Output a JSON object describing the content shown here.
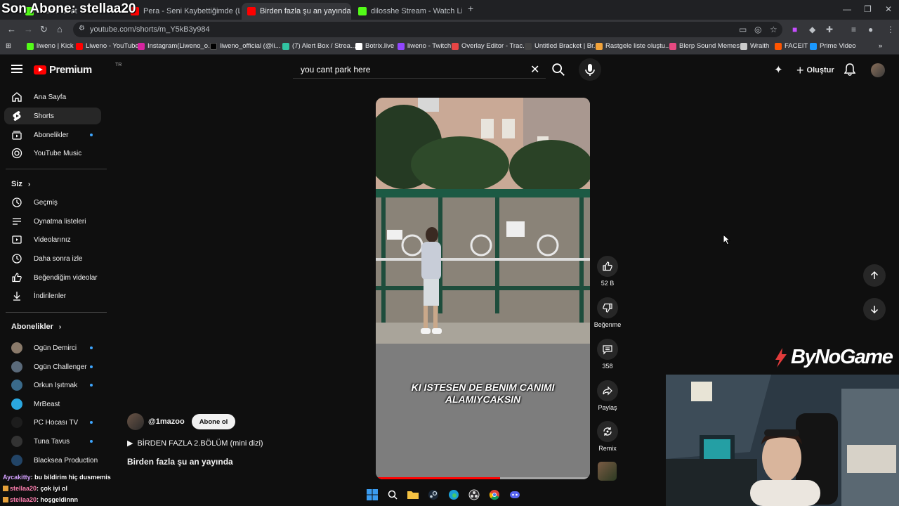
{
  "overlay": {
    "last_sub_label": "Son Abone: stellaa20",
    "sponsor": "ByNoGame"
  },
  "browser": {
    "tabs": [
      {
        "label": "…er… chat",
        "active": false
      },
      {
        "label": "Pera - Seni Kaybettiğimde (Lyric",
        "active": false
      },
      {
        "label": "Birden fazla şu an yayında",
        "active": true
      },
      {
        "label": "dilosshe Stream - Watch Live o",
        "active": false
      }
    ],
    "url": "youtube.com/shorts/m_Y5kB3y984",
    "bookmarks": [
      "liweno | Kick",
      "Liweno - YouTube",
      "Instagram(Liweno_o...",
      "liweno_official (@li...",
      "(7) Alert Box / Strea...",
      "Botrix.live",
      "liweno - Twitch",
      "Overlay Editor - Trac...",
      "Untitled Bracket | Br...",
      "Rastgele liste oluştu...",
      "Blerp Sound Memes...",
      "Wraith",
      "FACEIT",
      "Prime Video"
    ]
  },
  "header": {
    "logo": "Premium",
    "country": "TR",
    "search_value": "you cant park here",
    "create_label": "Oluştur"
  },
  "sidebar": {
    "main": [
      {
        "label": "Ana Sayfa",
        "icon": "home-icon"
      },
      {
        "label": "Shorts",
        "icon": "shorts-icon",
        "active": true
      },
      {
        "label": "Abonelikler",
        "icon": "subscriptions-icon",
        "dot": true
      },
      {
        "label": "YouTube Music",
        "icon": "music-icon"
      }
    ],
    "you_heading": "Siz",
    "you": [
      {
        "label": "Geçmiş",
        "icon": "history-icon"
      },
      {
        "label": "Oynatma listeleri",
        "icon": "playlists-icon"
      },
      {
        "label": "Videolarınız",
        "icon": "your-videos-icon"
      },
      {
        "label": "Daha sonra izle",
        "icon": "watch-later-icon"
      },
      {
        "label": "Beğendiğim videolar",
        "icon": "liked-icon"
      },
      {
        "label": "İndirilenler",
        "icon": "downloads-icon"
      }
    ],
    "subs_heading": "Abonelikler",
    "subs": [
      {
        "label": "Ogün Demirci",
        "color": "#8a7a6a",
        "dot": true
      },
      {
        "label": "Ogün Challenger",
        "color": "#5a6a7a",
        "dot": true
      },
      {
        "label": "Orkun Işıtmak",
        "color": "#3a6a8a",
        "dot": true
      },
      {
        "label": "MrBeast",
        "color": "#2aa7e0",
        "dot": false
      },
      {
        "label": "PC Hocası TV",
        "color": "#1d1d1d",
        "dot": true
      },
      {
        "label": "Tuna Tavus",
        "color": "#333333",
        "dot": true
      },
      {
        "label": "Blacksea Production",
        "color": "#224466",
        "dot": false
      }
    ]
  },
  "short": {
    "caption_line1": "KI ISTESEN DE BENIM CANIMI",
    "caption_line2": "ALAMIYCAKSIN",
    "progress": 0.58,
    "channel": "@1mazoo",
    "subscribe": "Abone ol",
    "playlist": "BİRDEN FAZLA 2.BÖLÜM (mini dizi)",
    "title": "Birden fazla şu an yayında",
    "likes": "52 B",
    "dislike_label": "Beğenme",
    "comments": "358",
    "share_label": "Paylaş",
    "remix_label": "Remix"
  },
  "chat": [
    {
      "user": "Aycakitty",
      "msg": ": bu bildirim hiç dusmemis"
    },
    {
      "user": "stellaa20",
      "msg": ": çok iyi ol"
    },
    {
      "user": "stellaa20",
      "msg": ": hoşgeldinnn"
    }
  ],
  "colors": {
    "accent": "#ff0000",
    "bg": "#0f0f0f",
    "badge": "#3ea6ff"
  }
}
